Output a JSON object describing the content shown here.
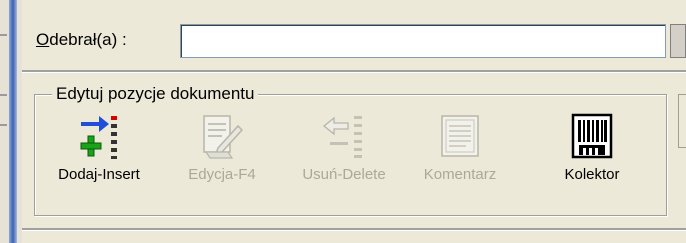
{
  "receiver": {
    "label": "Odebrał(a) :",
    "accesskey": "O",
    "value": ""
  },
  "group": {
    "title": "Edytuj  pozycje dokumentu"
  },
  "toolbar": [
    {
      "id": "add",
      "label": "Dodaj-Insert",
      "icon": "add-insert-icon",
      "enabled": true
    },
    {
      "id": "edit",
      "label": "Edycja-F4",
      "icon": "edit-document-icon",
      "enabled": false
    },
    {
      "id": "delete",
      "label": "Usuń-Delete",
      "icon": "delete-arrow-icon",
      "enabled": false
    },
    {
      "id": "comment",
      "label": "Komentarz",
      "icon": "comment-note-icon",
      "enabled": false
    },
    {
      "id": "collector",
      "label": "Kolektor",
      "icon": "barcode-collector-icon",
      "enabled": true
    }
  ],
  "colors": {
    "background": "#ece9d8",
    "disabled_text": "#aca899",
    "accent_blue": "#1f4fd8",
    "accent_red": "#d80000",
    "accent_green": "#1aa31a"
  }
}
